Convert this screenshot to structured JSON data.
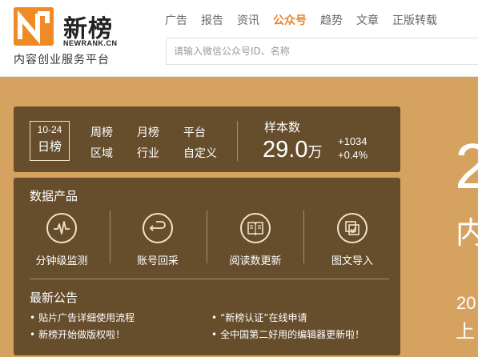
{
  "brand": {
    "name": "新榜",
    "name_en": "NEWRANK.CN",
    "slogan": "内容创业服务平台",
    "color": "#f08a24"
  },
  "nav": {
    "items": [
      "广告",
      "报告",
      "资讯",
      "公众号",
      "趋势",
      "文章",
      "正版转载"
    ],
    "active": "公众号"
  },
  "search": {
    "placeholder": "请输入微信公众号ID、名称",
    "value": ""
  },
  "ranking": {
    "date": "10-24",
    "current": "日榜",
    "links": [
      "周榜",
      "月榜",
      "平台",
      "区域",
      "行业",
      "自定义"
    ],
    "sample_title": "样本数",
    "sample_value": "29.0",
    "sample_unit": "万",
    "delta_abs": "+1034",
    "delta_pct": "+0.4%"
  },
  "products": {
    "title": "数据产品",
    "items": [
      {
        "label": "分钟级监测",
        "icon": "pulse-icon"
      },
      {
        "label": "账号回采",
        "icon": "return-icon"
      },
      {
        "label": "阅读数更新",
        "icon": "book-icon"
      },
      {
        "label": "图文导入",
        "icon": "import-icon"
      }
    ]
  },
  "notices": {
    "title": "最新公告",
    "items": [
      "贴片广告详细使用流程",
      "“新榜认证”在线申请",
      "新榜开始做版权啦！",
      "全中国第二好用的编辑器更新啦！"
    ]
  },
  "peek": {
    "big": "2",
    "char1": "内",
    "small": "20",
    "char2": "上"
  },
  "colors": {
    "background": "#d5a25f",
    "accent": "#e8862a",
    "panel": "#46341e"
  }
}
